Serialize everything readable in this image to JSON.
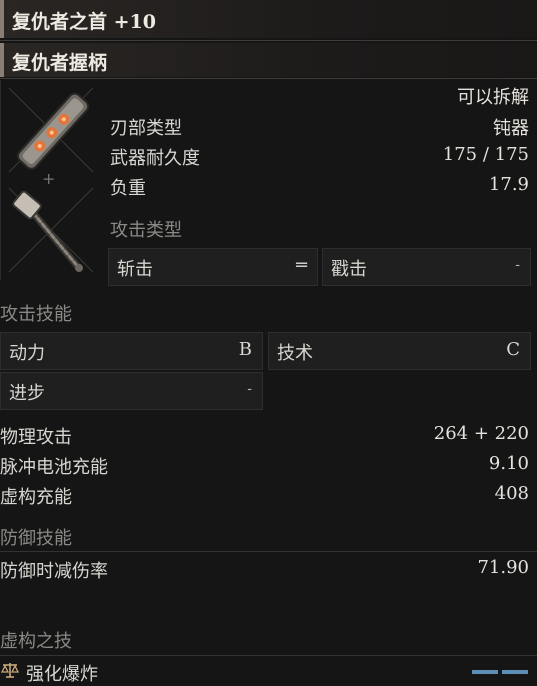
{
  "weapon": {
    "title": "复仇者之首 +10",
    "handle_name": "复仇者握柄",
    "plus_sign": "+",
    "dismantle": "可以拆解",
    "stats": [
      {
        "label": "刃部类型",
        "value": "钝器"
      },
      {
        "label": "武器耐久度",
        "value": "175 / 175"
      },
      {
        "label": "负重",
        "value": "17.9"
      }
    ]
  },
  "attack_type": {
    "heading": "攻击类型",
    "slots": [
      {
        "label": "斩击",
        "value": "═"
      },
      {
        "label": "戳击",
        "value": "-"
      }
    ]
  },
  "attack_skill": {
    "heading": "攻击技能",
    "cells": [
      {
        "label": "动力",
        "grade": "B"
      },
      {
        "label": "技术",
        "grade": "C"
      },
      {
        "label": "进步",
        "grade": "-"
      }
    ]
  },
  "attack_stats": [
    {
      "label": "物理攻击",
      "value": "264 + 220"
    },
    {
      "label": "脉冲电池充能",
      "value": "9.10"
    },
    {
      "label": "虚构充能",
      "value": "408"
    }
  ],
  "defense": {
    "heading": "防御技能",
    "rows": [
      {
        "label": "防御时减伤率",
        "value": "71.90"
      }
    ]
  },
  "fable": {
    "heading": "虚构之技",
    "icon": "scale-icon",
    "skill_name": "强化爆炸",
    "cost_segments": 2,
    "accent_color": "#5b8fb8"
  }
}
